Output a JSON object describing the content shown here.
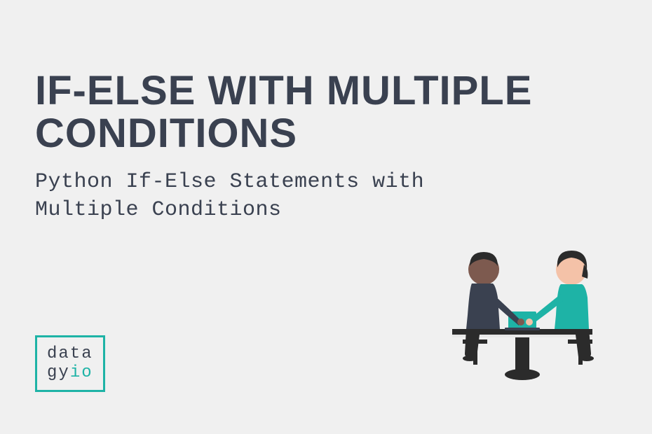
{
  "title": "IF-ELSE WITH MULTIPLE CONDITIONS",
  "subtitle": "Python If-Else Statements with Multiple Conditions",
  "logo": {
    "line1_part1": "data",
    "line2_part1": "gy",
    "line2_part2": "io"
  },
  "colors": {
    "text_dark": "#3a4150",
    "accent_teal": "#1eb3a6",
    "bg": "#f0f0f0"
  }
}
